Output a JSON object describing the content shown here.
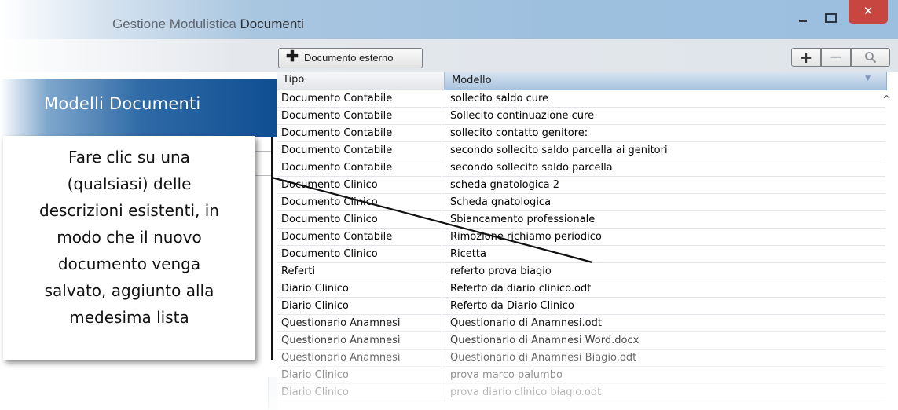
{
  "window": {
    "title_prefix": "Gestione Modulistica ",
    "title_suffix": "Documenti",
    "minimize": "",
    "maximize": "",
    "close": "✕"
  },
  "toolbar": {
    "external_doc_plus": "✚",
    "external_doc_label": "Documento esterno",
    "add": "+",
    "remove": "−"
  },
  "sidebar": {
    "title": "Modelli Documenti"
  },
  "table": {
    "columns": [
      "Tipo",
      "Modello"
    ],
    "rows": [
      {
        "tipo": "Documento Contabile",
        "modello": "sollecito saldo cure"
      },
      {
        "tipo": "Documento Contabile",
        "modello": "Sollecito continuazione cure"
      },
      {
        "tipo": "Documento Contabile",
        "modello": "sollecito contatto genitore:"
      },
      {
        "tipo": "Documento Contabile",
        "modello": "secondo sollecito saldo parcella ai genitori"
      },
      {
        "tipo": "Documento Contabile",
        "modello": "secondo sollecito saldo parcella"
      },
      {
        "tipo": "Documento Clinico",
        "modello": "scheda gnatologica 2"
      },
      {
        "tipo": "Documento Clinico",
        "modello": "Scheda gnatologica"
      },
      {
        "tipo": "Documento Clinico",
        "modello": "Sbiancamento professionale"
      },
      {
        "tipo": "Documento Contabile",
        "modello": "Rimozione richiamo periodico"
      },
      {
        "tipo": "Documento Clinico",
        "modello": "Ricetta"
      },
      {
        "tipo": "Referti",
        "modello": "referto prova biagio"
      },
      {
        "tipo": "Diario Clinico",
        "modello": "Referto da diario clinico.odt"
      },
      {
        "tipo": "Diario Clinico",
        "modello": "Referto da Diario Clinico"
      },
      {
        "tipo": "Questionario Anamnesi",
        "modello": "Questionario di Anamnesi.odt"
      },
      {
        "tipo": "Questionario Anamnesi",
        "modello": "Questionario di Anamnesi Word.docx"
      },
      {
        "tipo": "Questionario Anamnesi",
        "modello": "Questionario di Anamnesi Biagio.odt"
      },
      {
        "tipo": "Diario Clinico",
        "modello": "prova marco palumbo"
      },
      {
        "tipo": "Diario Clinico",
        "modello": "prova diario clinico biagio.odt"
      }
    ]
  },
  "callout": {
    "lines": [
      "Fare clic su una",
      "(qualsiasi) delle",
      "descrizioni esistenti, in",
      "modo che il nuovo",
      "documento venga",
      "salvato, aggiunto alla",
      "medesima lista"
    ]
  },
  "colors": {
    "accent": "#0f4e92",
    "close_button": "#c7463f",
    "header_selected": "#a9c3de"
  },
  "icons": {
    "plus": "plus-icon",
    "minus": "minus-icon",
    "search": "search-icon",
    "close": "close-icon",
    "sort": "sort-down-icon",
    "scroll_up": "chevron-up-icon"
  }
}
